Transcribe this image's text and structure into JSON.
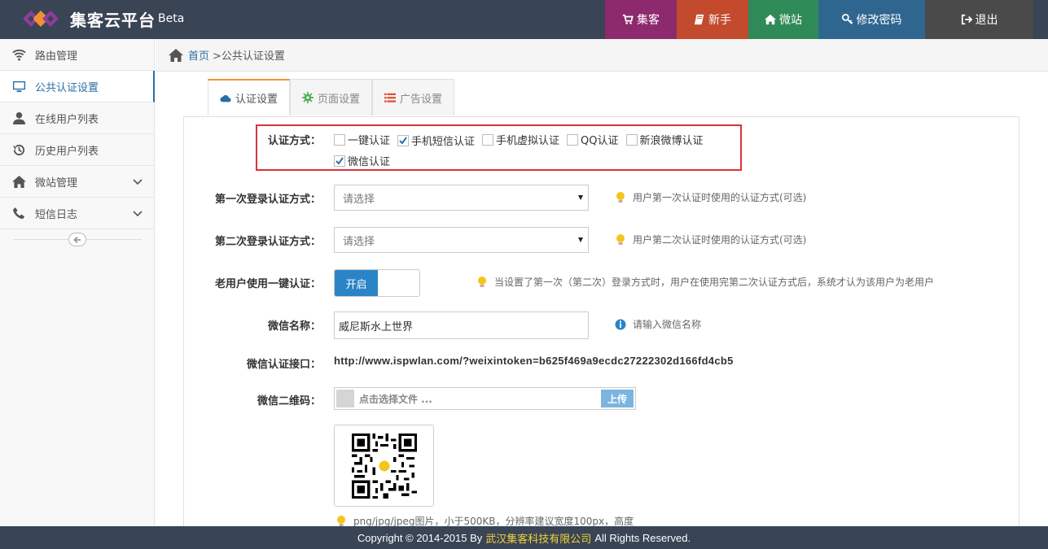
{
  "header": {
    "brand": "集客云平台",
    "beta": "Beta",
    "nav": [
      {
        "label": "集客",
        "icon": "cart-icon",
        "color": "#8c2a6d"
      },
      {
        "label": "新手",
        "icon": "book-icon",
        "color": "#c34a2c"
      },
      {
        "label": "微站",
        "icon": "home-icon",
        "color": "#2e8b57"
      },
      {
        "label": "修改密码",
        "icon": "key-icon",
        "color": "#2f6690"
      },
      {
        "label": "退出",
        "icon": "signout-icon",
        "color": "#4a4a4a"
      }
    ]
  },
  "sidebar": {
    "items": [
      {
        "label": "路由管理",
        "icon": "wifi-icon"
      },
      {
        "label": "公共认证设置",
        "icon": "monitor-icon",
        "active": true
      },
      {
        "label": "在线用户列表",
        "icon": "user-icon"
      },
      {
        "label": "历史用户列表",
        "icon": "history-icon"
      },
      {
        "label": "微站管理",
        "icon": "home-icon",
        "expandable": true
      },
      {
        "label": "短信日志",
        "icon": "phone-icon",
        "expandable": true
      }
    ]
  },
  "breadcrumb": {
    "home": "首页",
    "current": ">公共认证设置"
  },
  "tabs": [
    {
      "label": "认证设置",
      "icon": "cloud-icon",
      "active": true
    },
    {
      "label": "页面设置",
      "icon": "gear-icon"
    },
    {
      "label": "广告设置",
      "icon": "list-icon"
    }
  ],
  "form": {
    "auth_method": {
      "label": "认证方式：",
      "options": [
        {
          "label": "一键认证",
          "checked": false
        },
        {
          "label": "手机短信认证",
          "checked": true
        },
        {
          "label": "手机虚拟认证",
          "checked": false
        },
        {
          "label": "QQ认证",
          "checked": false
        },
        {
          "label": "新浪微博认证",
          "checked": false
        },
        {
          "label": "微信认证",
          "checked": true
        }
      ]
    },
    "first_login": {
      "label": "第一次登录认证方式：",
      "placeholder": "请选择",
      "hint": "用户第一次认证时使用的认证方式(可选)"
    },
    "second_login": {
      "label": "第二次登录认证方式：",
      "placeholder": "请选择",
      "hint": "用户第二次认证时使用的认证方式(可选)"
    },
    "old_user": {
      "label": "老用户使用一键认证：",
      "switch_on": "开启",
      "hint": "当设置了第一次（第二次）登录方式时，用户在使用完第二次认证方式后，系统才认为该用户为老用户"
    },
    "wechat_name": {
      "label": "微信名称：",
      "value": "威尼斯水上世界",
      "hint": "请输入微信名称"
    },
    "wechat_api": {
      "label": "微信认证接口：",
      "value": "http://www.ispwlan.com/?weixintoken=b625f469a9ecdc27222302d166fd4cb5"
    },
    "wechat_qr": {
      "label": "微信二维码：",
      "placeholder": "点击选择文件 ...",
      "upload": "上传",
      "hint": "png/jpg/jpeg图片，小于500KB，分辨率建议宽度100px，高度"
    }
  },
  "footer": {
    "prefix": "Copyright © 2014-2015 By",
    "company": "武汉集客科技有限公司",
    "suffix": "All Rights Reserved."
  },
  "colors": {
    "topbar": "#394455",
    "accent": "#2a6ea6",
    "highlight_box": "#d9333a",
    "tab_active_border": "#f29132"
  }
}
